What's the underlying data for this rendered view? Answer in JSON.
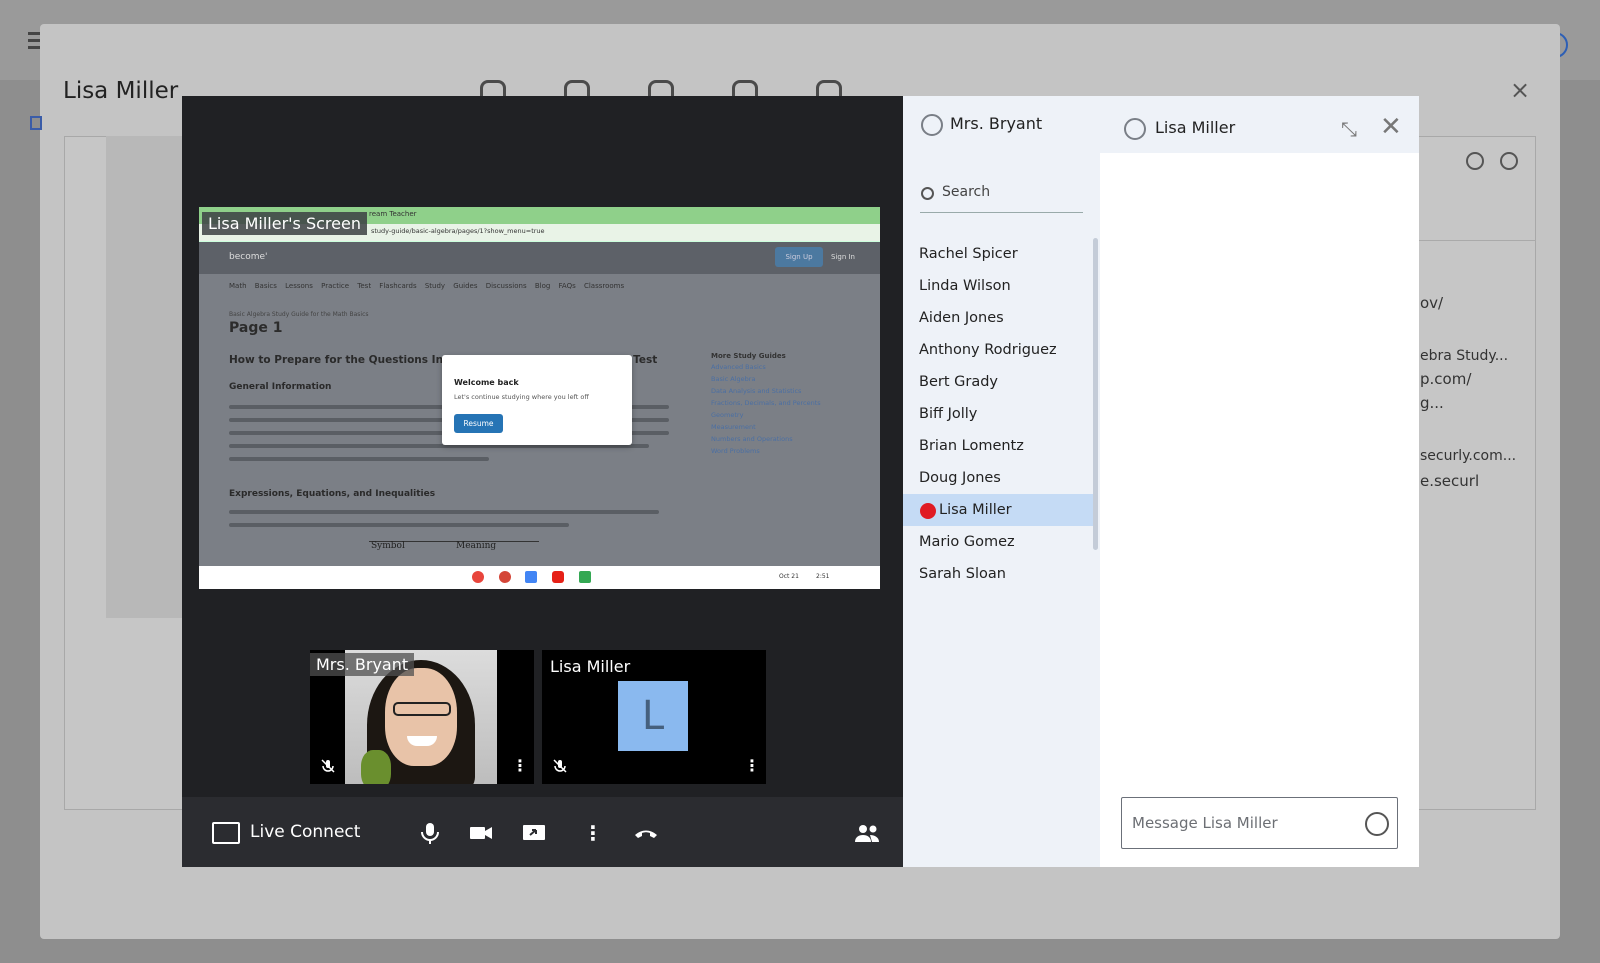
{
  "background": {
    "student_name": "Lisa Miller",
    "close_icon": "×",
    "peek_texts": [
      "ov/",
      "ebra Study...",
      "p.com/",
      "g...",
      "securly.com...",
      "e.securl"
    ]
  },
  "call": {
    "screen_label": "Lisa Miller's Screen",
    "shared_screen": {
      "tab_text": "ream Teacher",
      "url": "study-guide/basic-algebra/pages/1?show_menu=true",
      "logo": "become'",
      "signup": "Sign Up",
      "signin": "Sign In",
      "nav": "Math Basics  Lessons  Practice Test  Flashcards  Study Guides  Discussions  Blog  FAQs  Classrooms",
      "breadcrumb": "Basic Algebra Study Guide for the Math Basics",
      "page_title": "Page 1",
      "heading": "How to Prepare for the Questions Inv",
      "heading_tail": "ath Test",
      "section1": "General Information",
      "section2": "Expressions, Equations, and Inequalities",
      "table_h1": "Symbol",
      "table_h2": "Meaning",
      "side_title": "More Study Guides",
      "side_links": [
        "Advanced Basics",
        "Basic Algebra",
        "Data Analysis and Statistics",
        "Fractions, Decimals, and Percents",
        "Geometry",
        "Measurement",
        "Numbers and Operations",
        "Word Problems"
      ],
      "modal_title": "Welcome back",
      "modal_sub": "Let's continue studying where you left off",
      "resume": "Resume",
      "date": "Oct 21",
      "time": "2:51"
    },
    "tiles": [
      {
        "name": "Mrs. Bryant"
      },
      {
        "name": "Lisa Miller",
        "initial": "L"
      }
    ],
    "controls": {
      "brand": "Live Connect",
      "more": "⋮"
    }
  },
  "participants": {
    "host": "Mrs. Bryant",
    "search_placeholder": "Search",
    "list": [
      "Rachel Spicer",
      "Linda Wilson",
      "Aiden Jones",
      "Anthony Rodriguez",
      "Bert Grady",
      "Biff Jolly",
      "Brian Lomentz",
      "Doug Jones",
      "Lisa Miller",
      "Mario Gomez",
      "Sarah Sloan"
    ],
    "selected": "Lisa Miller"
  },
  "chat": {
    "title": "Lisa Miller",
    "minimize_icon": "⤡",
    "close_icon": "✕",
    "message_placeholder": "Message Lisa Miller"
  }
}
